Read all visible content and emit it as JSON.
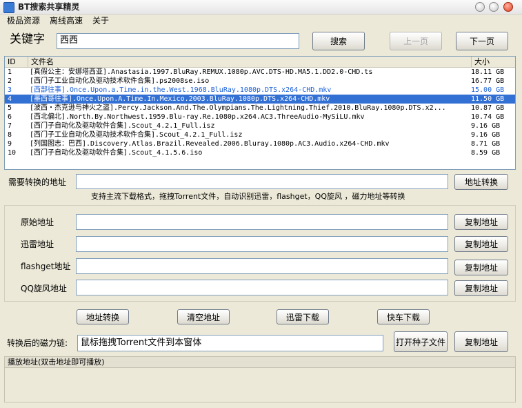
{
  "window": {
    "title": "BT搜索共享精灵"
  },
  "menu": [
    "极品资源",
    "离线高速",
    "关于"
  ],
  "search": {
    "label": "关键字",
    "value": "西西",
    "search_button": "搜索",
    "prev_button": "上一页",
    "next_button": "下一页"
  },
  "results": {
    "columns": [
      "ID",
      "文件名",
      "大小"
    ],
    "rows": [
      {
        "id": "1",
        "name": "[真假公主：安娜塔西亚].Anastasia.1997.BluRay.REMUX.1080p.AVC.DTS-HD.MA5.1.DD2.0-CHD.ts",
        "size": "18.11 GB",
        "state": "normal"
      },
      {
        "id": "2",
        "name": "[西门子工业自动化及驱动技术软件合集].ps2008se.iso",
        "size": "16.77 GB",
        "state": "normal"
      },
      {
        "id": "3",
        "name": "[西部往事].Once.Upon.a.Time.in.the.West.1968.BluRay.1080p.DTS.x264-CHD.mkv",
        "size": "15.00 GB",
        "state": "blue"
      },
      {
        "id": "4",
        "name": "[墨西哥往事].Once.Upon.A.Time.In.Mexico.2003.BluRay.1080p.DTS.x264-CHD.mkv",
        "size": "11.50 GB",
        "state": "selected"
      },
      {
        "id": "5",
        "name": "[波西・杰克逊与神火之盗].Percy.Jackson.And.The.Olympians.The.Lightning.Thief.2010.BluRay.1080p.DTS.x2...",
        "size": "10.87 GB",
        "state": "normal"
      },
      {
        "id": "6",
        "name": "[西北偏北].North.By.Northwest.1959.Blu-ray.Re.1080p.x264.AC3.ThreeAudio-MySiLU.mkv",
        "size": "10.74 GB",
        "state": "normal"
      },
      {
        "id": "7",
        "name": "[西门子自动化及驱动软件合集].Scout_4.2.1_Full.isz",
        "size": "9.16 GB",
        "state": "normal"
      },
      {
        "id": "8",
        "name": "[西门子工业自动化及驱动技术软件合集].Scout_4.2.1_Full.isz",
        "size": "9.16 GB",
        "state": "normal"
      },
      {
        "id": "9",
        "name": "[列国图志：巴西].Discovery.Atlas.Brazil.Revealed.2006.Bluray.1080p.AC3.Audio.x264-CHD.mkv",
        "size": "8.71 GB",
        "state": "normal"
      },
      {
        "id": "10",
        "name": "[西门子自动化及驱动软件合集].Scout_4.1.5.6.iso",
        "size": "8.59 GB",
        "state": "normal"
      }
    ]
  },
  "convert": {
    "label": "需要转换的地址",
    "value": "",
    "button": "地址转换",
    "hint": "支持主流下载格式，拖拽Torrent文件，自动识别迅雷，flashget，QQ旋风 ，磁力地址等转换"
  },
  "addresses": [
    {
      "label": "原始地址",
      "value": "",
      "button": "复制地址"
    },
    {
      "label": "迅雷地址",
      "value": "",
      "button": "复制地址"
    },
    {
      "label": "flashget地址",
      "value": "",
      "button": "复制地址"
    },
    {
      "label": "QQ旋风地址",
      "value": "",
      "button": "复制地址"
    }
  ],
  "actions": [
    "地址转换",
    "清空地址",
    "迅雷下载",
    "快车下载"
  ],
  "magnet": {
    "label": "转换后的磁力链:",
    "value": "鼠标拖拽Torrent文件到本窗体",
    "open_button": "打开种子文件",
    "copy_button": "复制地址"
  },
  "play": {
    "header": "播放地址(双击地址即可播放)"
  }
}
